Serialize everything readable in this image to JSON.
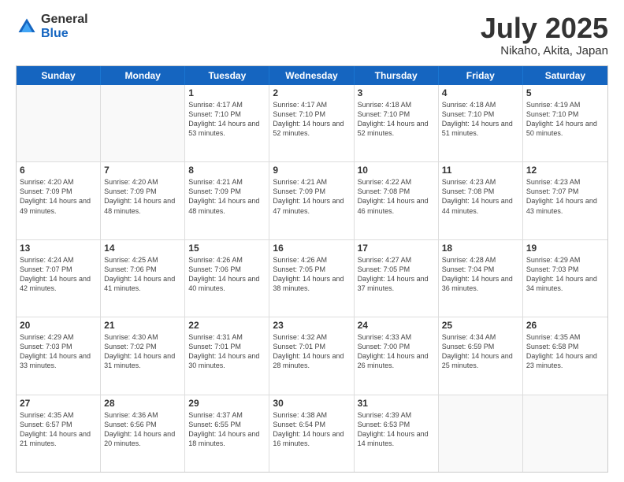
{
  "header": {
    "logo_general": "General",
    "logo_blue": "Blue",
    "title": "July 2025",
    "location": "Nikaho, Akita, Japan"
  },
  "weekdays": [
    "Sunday",
    "Monday",
    "Tuesday",
    "Wednesday",
    "Thursday",
    "Friday",
    "Saturday"
  ],
  "weeks": [
    [
      {
        "day": "",
        "empty": true
      },
      {
        "day": "",
        "empty": true
      },
      {
        "day": "1",
        "sunrise": "Sunrise: 4:17 AM",
        "sunset": "Sunset: 7:10 PM",
        "daylight": "Daylight: 14 hours and 53 minutes."
      },
      {
        "day": "2",
        "sunrise": "Sunrise: 4:17 AM",
        "sunset": "Sunset: 7:10 PM",
        "daylight": "Daylight: 14 hours and 52 minutes."
      },
      {
        "day": "3",
        "sunrise": "Sunrise: 4:18 AM",
        "sunset": "Sunset: 7:10 PM",
        "daylight": "Daylight: 14 hours and 52 minutes."
      },
      {
        "day": "4",
        "sunrise": "Sunrise: 4:18 AM",
        "sunset": "Sunset: 7:10 PM",
        "daylight": "Daylight: 14 hours and 51 minutes."
      },
      {
        "day": "5",
        "sunrise": "Sunrise: 4:19 AM",
        "sunset": "Sunset: 7:10 PM",
        "daylight": "Daylight: 14 hours and 50 minutes."
      }
    ],
    [
      {
        "day": "6",
        "sunrise": "Sunrise: 4:20 AM",
        "sunset": "Sunset: 7:09 PM",
        "daylight": "Daylight: 14 hours and 49 minutes."
      },
      {
        "day": "7",
        "sunrise": "Sunrise: 4:20 AM",
        "sunset": "Sunset: 7:09 PM",
        "daylight": "Daylight: 14 hours and 48 minutes."
      },
      {
        "day": "8",
        "sunrise": "Sunrise: 4:21 AM",
        "sunset": "Sunset: 7:09 PM",
        "daylight": "Daylight: 14 hours and 48 minutes."
      },
      {
        "day": "9",
        "sunrise": "Sunrise: 4:21 AM",
        "sunset": "Sunset: 7:09 PM",
        "daylight": "Daylight: 14 hours and 47 minutes."
      },
      {
        "day": "10",
        "sunrise": "Sunrise: 4:22 AM",
        "sunset": "Sunset: 7:08 PM",
        "daylight": "Daylight: 14 hours and 46 minutes."
      },
      {
        "day": "11",
        "sunrise": "Sunrise: 4:23 AM",
        "sunset": "Sunset: 7:08 PM",
        "daylight": "Daylight: 14 hours and 44 minutes."
      },
      {
        "day": "12",
        "sunrise": "Sunrise: 4:23 AM",
        "sunset": "Sunset: 7:07 PM",
        "daylight": "Daylight: 14 hours and 43 minutes."
      }
    ],
    [
      {
        "day": "13",
        "sunrise": "Sunrise: 4:24 AM",
        "sunset": "Sunset: 7:07 PM",
        "daylight": "Daylight: 14 hours and 42 minutes."
      },
      {
        "day": "14",
        "sunrise": "Sunrise: 4:25 AM",
        "sunset": "Sunset: 7:06 PM",
        "daylight": "Daylight: 14 hours and 41 minutes."
      },
      {
        "day": "15",
        "sunrise": "Sunrise: 4:26 AM",
        "sunset": "Sunset: 7:06 PM",
        "daylight": "Daylight: 14 hours and 40 minutes."
      },
      {
        "day": "16",
        "sunrise": "Sunrise: 4:26 AM",
        "sunset": "Sunset: 7:05 PM",
        "daylight": "Daylight: 14 hours and 38 minutes."
      },
      {
        "day": "17",
        "sunrise": "Sunrise: 4:27 AM",
        "sunset": "Sunset: 7:05 PM",
        "daylight": "Daylight: 14 hours and 37 minutes."
      },
      {
        "day": "18",
        "sunrise": "Sunrise: 4:28 AM",
        "sunset": "Sunset: 7:04 PM",
        "daylight": "Daylight: 14 hours and 36 minutes."
      },
      {
        "day": "19",
        "sunrise": "Sunrise: 4:29 AM",
        "sunset": "Sunset: 7:03 PM",
        "daylight": "Daylight: 14 hours and 34 minutes."
      }
    ],
    [
      {
        "day": "20",
        "sunrise": "Sunrise: 4:29 AM",
        "sunset": "Sunset: 7:03 PM",
        "daylight": "Daylight: 14 hours and 33 minutes."
      },
      {
        "day": "21",
        "sunrise": "Sunrise: 4:30 AM",
        "sunset": "Sunset: 7:02 PM",
        "daylight": "Daylight: 14 hours and 31 minutes."
      },
      {
        "day": "22",
        "sunrise": "Sunrise: 4:31 AM",
        "sunset": "Sunset: 7:01 PM",
        "daylight": "Daylight: 14 hours and 30 minutes."
      },
      {
        "day": "23",
        "sunrise": "Sunrise: 4:32 AM",
        "sunset": "Sunset: 7:01 PM",
        "daylight": "Daylight: 14 hours and 28 minutes."
      },
      {
        "day": "24",
        "sunrise": "Sunrise: 4:33 AM",
        "sunset": "Sunset: 7:00 PM",
        "daylight": "Daylight: 14 hours and 26 minutes."
      },
      {
        "day": "25",
        "sunrise": "Sunrise: 4:34 AM",
        "sunset": "Sunset: 6:59 PM",
        "daylight": "Daylight: 14 hours and 25 minutes."
      },
      {
        "day": "26",
        "sunrise": "Sunrise: 4:35 AM",
        "sunset": "Sunset: 6:58 PM",
        "daylight": "Daylight: 14 hours and 23 minutes."
      }
    ],
    [
      {
        "day": "27",
        "sunrise": "Sunrise: 4:35 AM",
        "sunset": "Sunset: 6:57 PM",
        "daylight": "Daylight: 14 hours and 21 minutes."
      },
      {
        "day": "28",
        "sunrise": "Sunrise: 4:36 AM",
        "sunset": "Sunset: 6:56 PM",
        "daylight": "Daylight: 14 hours and 20 minutes."
      },
      {
        "day": "29",
        "sunrise": "Sunrise: 4:37 AM",
        "sunset": "Sunset: 6:55 PM",
        "daylight": "Daylight: 14 hours and 18 minutes."
      },
      {
        "day": "30",
        "sunrise": "Sunrise: 4:38 AM",
        "sunset": "Sunset: 6:54 PM",
        "daylight": "Daylight: 14 hours and 16 minutes."
      },
      {
        "day": "31",
        "sunrise": "Sunrise: 4:39 AM",
        "sunset": "Sunset: 6:53 PM",
        "daylight": "Daylight: 14 hours and 14 minutes."
      },
      {
        "day": "",
        "empty": true
      },
      {
        "day": "",
        "empty": true
      }
    ]
  ]
}
